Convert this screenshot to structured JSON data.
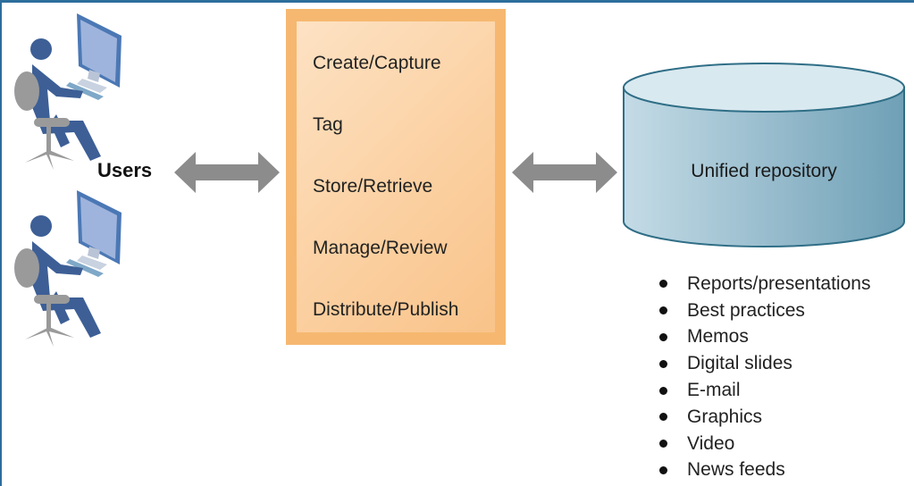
{
  "users": {
    "label": "Users"
  },
  "process": {
    "steps": [
      "Create/Capture",
      "Tag",
      "Store/Retrieve",
      "Manage/Review",
      "Distribute/Publish"
    ]
  },
  "repository": {
    "label": "Unified repository",
    "items": [
      "Reports/presentations",
      "Best practices",
      "Memos",
      "Digital slides",
      "E-mail",
      "Graphics",
      "Video",
      "News feeds"
    ]
  },
  "colors": {
    "user_figure": "#3d5f96",
    "chair": "#9a9a9a",
    "arrow": "#8c8c8c",
    "box": "#f6b870",
    "cylinder": "#8fb7c9",
    "frame": "#2d6e9c"
  }
}
